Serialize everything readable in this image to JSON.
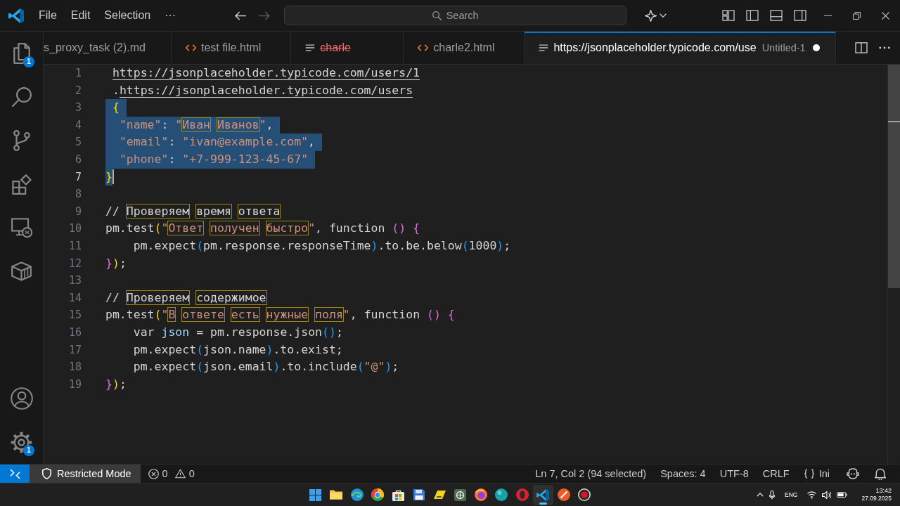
{
  "title_bar": {
    "menu": [
      "File",
      "Edit",
      "Selection",
      "···"
    ],
    "nav": [
      {
        "kind": "back",
        "disabled": false
      },
      {
        "kind": "forward",
        "disabled": true
      }
    ],
    "search": {
      "placeholder": "Search"
    }
  },
  "activity_bar": {
    "top": [
      {
        "kind": "files",
        "badge": "1"
      },
      {
        "kind": "search"
      },
      {
        "kind": "branch"
      },
      {
        "kind": "blocks"
      },
      {
        "kind": "monitor"
      },
      {
        "kind": "box"
      }
    ],
    "bottom": [
      {
        "kind": "account"
      },
      {
        "kind": "settings",
        "badge": "1"
      }
    ]
  },
  "tabs": [
    {
      "label": "s_proxy_task (2).md",
      "selected": false,
      "deleted": false,
      "dirty": false
    },
    {
      "label": "test file.html",
      "kind": "html",
      "selected": false,
      "deleted": false,
      "dirty": false
    },
    {
      "label": "charle",
      "kind": "text",
      "selected": false,
      "deleted": true,
      "dirty": false
    },
    {
      "label": "charle2.html",
      "kind": "html",
      "selected": false,
      "deleted": false,
      "dirty": false
    },
    {
      "label": "https://jsonplaceholder.typicode.com/use",
      "description": "Untitled-1",
      "kind": "text",
      "selected": true,
      "deleted": false,
      "dirty": true
    }
  ],
  "editor": {
    "lines": [
      {
        "number": "1",
        "selected": false,
        "current": false,
        "tokens": [
          {
            "kind": "link",
            "text": " https://jsonplaceholder.typicode.com/users/1"
          }
        ]
      },
      {
        "number": "2",
        "selected": false,
        "current": false,
        "tokens": [
          {
            "kind": "text",
            "text": " ."
          },
          {
            "kind": "link",
            "text": "https://jsonplaceholder.typicode.com/users"
          }
        ]
      },
      {
        "number": "3",
        "selected": true,
        "current": false,
        "tokens": [
          {
            "kind": "bracket",
            "text": " {",
            "color": "#ffd700"
          }
        ]
      },
      {
        "number": "4",
        "selected": true,
        "current": false,
        "tokens": [
          {
            "kind": "string",
            "text": "  \"name\""
          },
          {
            "kind": "text",
            "text": ": "
          },
          {
            "kind": "string",
            "text": "\""
          },
          {
            "kind": "marked-string",
            "text": "Иван"
          },
          {
            "kind": "marked-string",
            "text": " Иванов"
          },
          {
            "kind": "string",
            "text": "\""
          },
          {
            "kind": "text",
            "text": ","
          }
        ]
      },
      {
        "number": "5",
        "selected": true,
        "current": false,
        "tokens": [
          {
            "kind": "string",
            "text": "  \"email\""
          },
          {
            "kind": "text",
            "text": ": "
          },
          {
            "kind": "string",
            "text": "\"ivan@example.com\""
          },
          {
            "kind": "text",
            "text": ","
          }
        ]
      },
      {
        "number": "6",
        "selected": true,
        "current": false,
        "tokens": [
          {
            "kind": "string",
            "text": "  \"phone\""
          },
          {
            "kind": "text",
            "text": ": "
          },
          {
            "kind": "string",
            "text": "\"+7-999-123-45-67\""
          }
        ]
      },
      {
        "number": "7",
        "selected": true,
        "current": true,
        "tokens": [
          {
            "kind": "bracket",
            "text": "}",
            "color": "#ffd700"
          }
        ]
      },
      {
        "number": "8",
        "selected": false,
        "current": false
      },
      {
        "number": "9",
        "selected": false,
        "current": false,
        "tokens": [
          {
            "kind": "text",
            "text": "// "
          },
          {
            "kind": "marked-text",
            "text": "Проверяем"
          },
          {
            "kind": "marked-text",
            "text": " время"
          },
          {
            "kind": "marked-text",
            "text": " ответа"
          }
        ]
      },
      {
        "number": "10",
        "selected": false,
        "current": false,
        "tokens": [
          {
            "kind": "text",
            "text": "pm.test"
          },
          {
            "kind": "bracket",
            "text": "(",
            "color": "#ffd700"
          },
          {
            "kind": "string",
            "text": "\""
          },
          {
            "kind": "marked-string",
            "text": "Ответ"
          },
          {
            "kind": "marked-string",
            "text": " получен"
          },
          {
            "kind": "marked-string",
            "text": " быстро"
          },
          {
            "kind": "string",
            "text": "\""
          },
          {
            "kind": "text",
            "text": ", function "
          },
          {
            "kind": "bracket",
            "text": "()",
            "color": "#da70d6"
          },
          {
            "kind": "bracket",
            "text": " {",
            "color": "#da70d6"
          }
        ]
      },
      {
        "number": "11",
        "selected": false,
        "current": false,
        "tokens": [
          {
            "kind": "text",
            "text": "    pm.expect"
          },
          {
            "kind": "bracket",
            "text": "(",
            "color": "#179fff"
          },
          {
            "kind": "text",
            "text": "pm.response.responseTime"
          },
          {
            "kind": "bracket",
            "text": ")",
            "color": "#179fff"
          },
          {
            "kind": "text",
            "text": ".to.be.below"
          },
          {
            "kind": "bracket",
            "text": "(",
            "color": "#179fff"
          },
          {
            "kind": "text",
            "text": "1000"
          },
          {
            "kind": "bracket",
            "text": ")",
            "color": "#179fff"
          },
          {
            "kind": "text",
            "text": ";"
          }
        ]
      },
      {
        "number": "12",
        "selected": false,
        "current": false,
        "tokens": [
          {
            "kind": "bracket",
            "text": "}",
            "color": "#da70d6"
          },
          {
            "kind": "bracket",
            "text": ")",
            "color": "#ffd700"
          },
          {
            "kind": "text",
            "text": ";"
          }
        ]
      },
      {
        "number": "13",
        "selected": false,
        "current": false
      },
      {
        "number": "14",
        "selected": false,
        "current": false,
        "tokens": [
          {
            "kind": "text",
            "text": "// "
          },
          {
            "kind": "marked-text",
            "text": "Проверяем"
          },
          {
            "kind": "marked-text",
            "text": " содержимое"
          }
        ]
      },
      {
        "number": "15",
        "selected": false,
        "current": false,
        "tokens": [
          {
            "kind": "text",
            "text": "pm.test"
          },
          {
            "kind": "bracket",
            "text": "(",
            "color": "#ffd700"
          },
          {
            "kind": "string",
            "text": "\""
          },
          {
            "kind": "marked-string",
            "text": "В"
          },
          {
            "kind": "marked-string",
            "text": " ответе"
          },
          {
            "kind": "marked-string",
            "text": " есть"
          },
          {
            "kind": "marked-string",
            "text": " нужные"
          },
          {
            "kind": "marked-string",
            "text": " поля"
          },
          {
            "kind": "string",
            "text": "\""
          },
          {
            "kind": "text",
            "text": ", function "
          },
          {
            "kind": "bracket",
            "text": "()",
            "color": "#da70d6"
          },
          {
            "kind": "bracket",
            "text": " {",
            "color": "#da70d6"
          }
        ]
      },
      {
        "number": "16",
        "selected": false,
        "current": false,
        "tokens": [
          {
            "kind": "text",
            "text": "    var "
          },
          {
            "kind": "variable",
            "text": "json"
          },
          {
            "kind": "text",
            "text": " = pm.response.json"
          },
          {
            "kind": "bracket",
            "text": "()",
            "color": "#179fff"
          },
          {
            "kind": "text",
            "text": ";"
          }
        ]
      },
      {
        "number": "17",
        "selected": false,
        "current": false,
        "tokens": [
          {
            "kind": "text",
            "text": "    pm.expect"
          },
          {
            "kind": "bracket",
            "text": "(",
            "color": "#179fff"
          },
          {
            "kind": "text",
            "text": "json.name"
          },
          {
            "kind": "bracket",
            "text": ")",
            "color": "#179fff"
          },
          {
            "kind": "text",
            "text": ".to.exist;"
          }
        ]
      },
      {
        "number": "18",
        "selected": false,
        "current": false,
        "tokens": [
          {
            "kind": "text",
            "text": "    pm.expect"
          },
          {
            "kind": "bracket",
            "text": "(",
            "color": "#179fff"
          },
          {
            "kind": "text",
            "text": "json.email"
          },
          {
            "kind": "bracket",
            "text": ")",
            "color": "#179fff"
          },
          {
            "kind": "text",
            "text": ".to.include"
          },
          {
            "kind": "bracket",
            "text": "(",
            "color": "#179fff"
          },
          {
            "kind": "string",
            "text": "\"@\""
          },
          {
            "kind": "bracket",
            "text": ")",
            "color": "#179fff"
          },
          {
            "kind": "text",
            "text": ";"
          }
        ]
      },
      {
        "number": "19",
        "selected": false,
        "current": false,
        "tokens": [
          {
            "kind": "bracket",
            "text": "}",
            "color": "#da70d6"
          },
          {
            "kind": "bracket",
            "text": ")",
            "color": "#ffd700"
          },
          {
            "kind": "text",
            "text": ";"
          }
        ]
      }
    ]
  },
  "status_bar": {
    "restricted": "Restricted Mode",
    "errors": "0",
    "warnings": "0",
    "position": "Ln 7, Col 2 (94 selected)",
    "indentation": "Spaces: 4",
    "encoding": "UTF-8",
    "eol": "CRLF",
    "language": "Ini"
  },
  "taskbar": {
    "apps": [
      {
        "kind": "start",
        "selected": false
      },
      {
        "kind": "folder",
        "selected": false
      },
      {
        "kind": "swirl",
        "selected": false
      },
      {
        "kind": "wheel",
        "selected": false
      },
      {
        "kind": "bag",
        "selected": false
      },
      {
        "kind": "disk",
        "selected": false
      },
      {
        "kind": "tag",
        "selected": false
      },
      {
        "kind": "tile",
        "selected": false
      },
      {
        "kind": "flame",
        "selected": false
      },
      {
        "kind": "orb",
        "selected": false
      },
      {
        "kind": "ring",
        "selected": false
      },
      {
        "kind": "editor",
        "selected": true
      },
      {
        "kind": "pen",
        "selected": false
      },
      {
        "kind": "record",
        "selected": false
      }
    ],
    "language": "ENG",
    "time": "13:42",
    "date": "27.09.2025"
  }
}
